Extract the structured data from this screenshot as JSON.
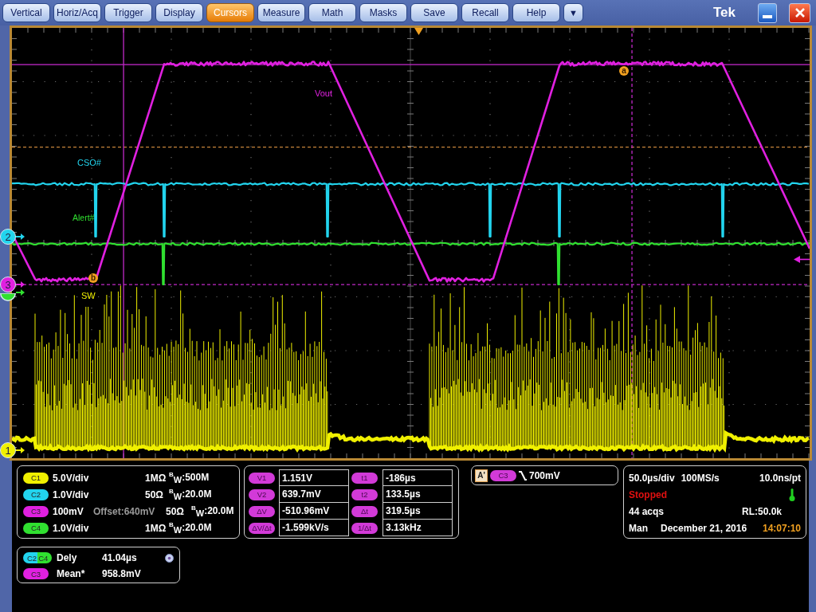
{
  "menu": {
    "buttons": [
      {
        "label": "Vertical",
        "selected": false
      },
      {
        "label": "Horiz/Acq",
        "selected": false
      },
      {
        "label": "Trigger",
        "selected": false
      },
      {
        "label": "Display",
        "selected": false
      },
      {
        "label": "Cursors",
        "selected": true
      },
      {
        "label": "Measure",
        "selected": false
      },
      {
        "label": "Math",
        "selected": false
      },
      {
        "label": "Masks",
        "selected": false
      },
      {
        "label": "Save",
        "selected": false
      },
      {
        "label": "Recall",
        "selected": false
      },
      {
        "label": "Help",
        "selected": false
      }
    ],
    "more": "▼"
  },
  "brand": "Tek",
  "display": {
    "traces": [
      {
        "label": "Vout",
        "kind": "ramp",
        "color": "#e020e0"
      },
      {
        "label": "CSO#",
        "kind": "pulse",
        "color": "#22d4ee"
      },
      {
        "label": "Alert#",
        "kind": "pulse",
        "color": "#30e030"
      },
      {
        "label": "SW",
        "kind": "burst",
        "color": "#f0f000"
      }
    ],
    "cursor_markers": [
      "a",
      "b"
    ],
    "channel_markers": [
      {
        "label": "2",
        "color": "#22d4ee"
      },
      {
        "label": "3",
        "color": "#e020e0"
      },
      {
        "color": "#30e030"
      },
      {
        "label": "1",
        "color": "#f0f000"
      }
    ]
  },
  "channels": [
    {
      "name": "C1",
      "color": "#f0f000",
      "scale": "5.0V/div",
      "impedance": "1MΩ",
      "bandwidth": "$^{B}$$_{W}$:500M"
    },
    {
      "name": "C2",
      "color": "#22d4ee",
      "scale": "1.0V/div",
      "impedance": "50Ω",
      "bandwidth": "$^{B}$$_{W}$:20.0M"
    },
    {
      "name": "C3",
      "color": "#e020e0",
      "scale": "100mV",
      "offset": "Offset:640mV",
      "impedance": "50Ω",
      "bandwidth": "$^{B}$$_{W}$:20.0M"
    },
    {
      "name": "C4",
      "color": "#30e030",
      "scale": "1.0V/div",
      "impedance": "1MΩ",
      "bandwidth": "$^{B}$$_{W}$:20.0M"
    }
  ],
  "cursor_readout": {
    "rows": [
      {
        "label": "V1",
        "value": "1.151V",
        "time_label": "t1",
        "time_value": "-186µs"
      },
      {
        "label": "V2",
        "value": "639.7mV",
        "time_label": "t2",
        "time_value": "133.5µs"
      },
      {
        "label": "ΔV",
        "value": "-510.96mV",
        "time_label": "Δt",
        "time_value": "319.5µs"
      },
      {
        "label": "ΔV/Δt",
        "value": "-1.599kV/s",
        "time_label": "1/Δt",
        "time_value": "3.13kHz"
      }
    ]
  },
  "trigger": {
    "mode": "A'",
    "source": "C3",
    "threshold": "700mV"
  },
  "acquisition": {
    "timebase": "50.0µs/div",
    "sample_rate": "100MS/s",
    "resolution": "10.0ns/pt",
    "status": "Stopped",
    "acquisitions": "44 acqs",
    "record_length": "RL:50.0k",
    "mode": "Man",
    "date": "December 21, 2016",
    "time": "14:07:10"
  },
  "measurements": [
    {
      "sources": [
        {
          "label": "C2",
          "color": "#22d4ee"
        },
        {
          "label": "C4",
          "color": "#30e030"
        }
      ],
      "name": "Dely",
      "value": "41.04µs"
    },
    {
      "sources": [
        {
          "label": "C3",
          "color": "#e020e0"
        }
      ],
      "name": "Mean*",
      "value": "958.8mV"
    }
  ]
}
